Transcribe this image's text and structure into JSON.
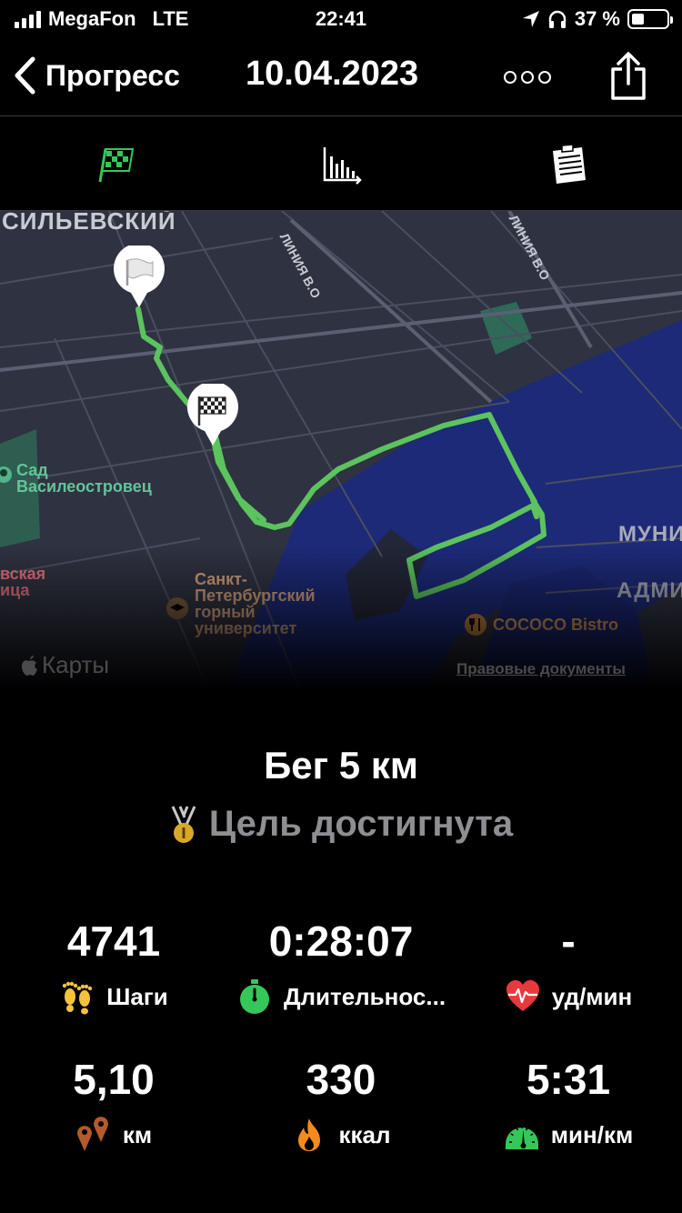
{
  "status_bar": {
    "carrier": "MegaFon",
    "network": "LTE",
    "time": "22:41",
    "battery": "37 %",
    "battery_level": 0.37
  },
  "nav": {
    "back_label": "Прогресс",
    "date": "10.04.2023"
  },
  "tabs": [
    "route-flag-icon",
    "chart-icon",
    "notes-icon"
  ],
  "map": {
    "labels": {
      "district": "СИЛЬЕВСКИЙ",
      "street_left": "ЛИНИЯ В.О",
      "street_right": "ЛИНИЯ В.О",
      "garden": "Сад\nВасилеостровец",
      "university": "Санкт-\nПетербургский\nгорный\nуниверситет",
      "left_cut": "вская\nица",
      "right_top": "МУНИ",
      "right_bottom": "АДМИ",
      "restaurant": "COCOCO Bistro",
      "maps_brand": "Карты",
      "legal": "Правовые документы"
    },
    "route_color": "#5cc35e",
    "water_color": "#1c2a78"
  },
  "activity": {
    "title": "Бег 5 км",
    "goal_text": "Цель достигнута"
  },
  "stats": [
    {
      "value": "4741",
      "label": "Шаги",
      "icon": "footprints-icon"
    },
    {
      "value": "0:28:07",
      "label": "Длительнос...",
      "icon": "stopwatch-icon"
    },
    {
      "value": "-",
      "label": "уд/мин",
      "icon": "heart-rate-icon"
    },
    {
      "value": "5,10",
      "label": "км",
      "icon": "location-pins-icon"
    },
    {
      "value": "330",
      "label": "ккал",
      "icon": "flame-icon"
    },
    {
      "value": "5:31",
      "label": "мин/км",
      "icon": "speedometer-icon"
    }
  ]
}
